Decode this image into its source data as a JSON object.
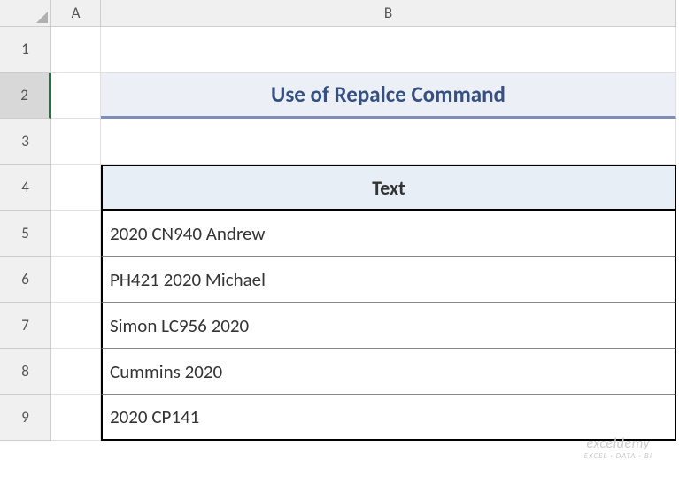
{
  "columns": [
    "A",
    "B"
  ],
  "rows": [
    "1",
    "2",
    "3",
    "4",
    "5",
    "6",
    "7",
    "8",
    "9"
  ],
  "title": "Use of Repalce Command",
  "table": {
    "header": "Text",
    "data": [
      "2020 CN940 Andrew",
      "PH421 2020 Michael",
      "Simon LC956 2020",
      "Cummins 2020",
      "2020 CP141"
    ]
  },
  "watermark": {
    "main": "exceldemy",
    "sub": "EXCEL · DATA · BI"
  },
  "chart_data": {
    "type": "table",
    "title": "Use of Repalce Command",
    "columns": [
      "Text"
    ],
    "rows": [
      [
        "2020 CN940 Andrew"
      ],
      [
        "PH421 2020 Michael"
      ],
      [
        "Simon LC956 2020"
      ],
      [
        "Cummins 2020"
      ],
      [
        "2020 CP141"
      ]
    ]
  }
}
